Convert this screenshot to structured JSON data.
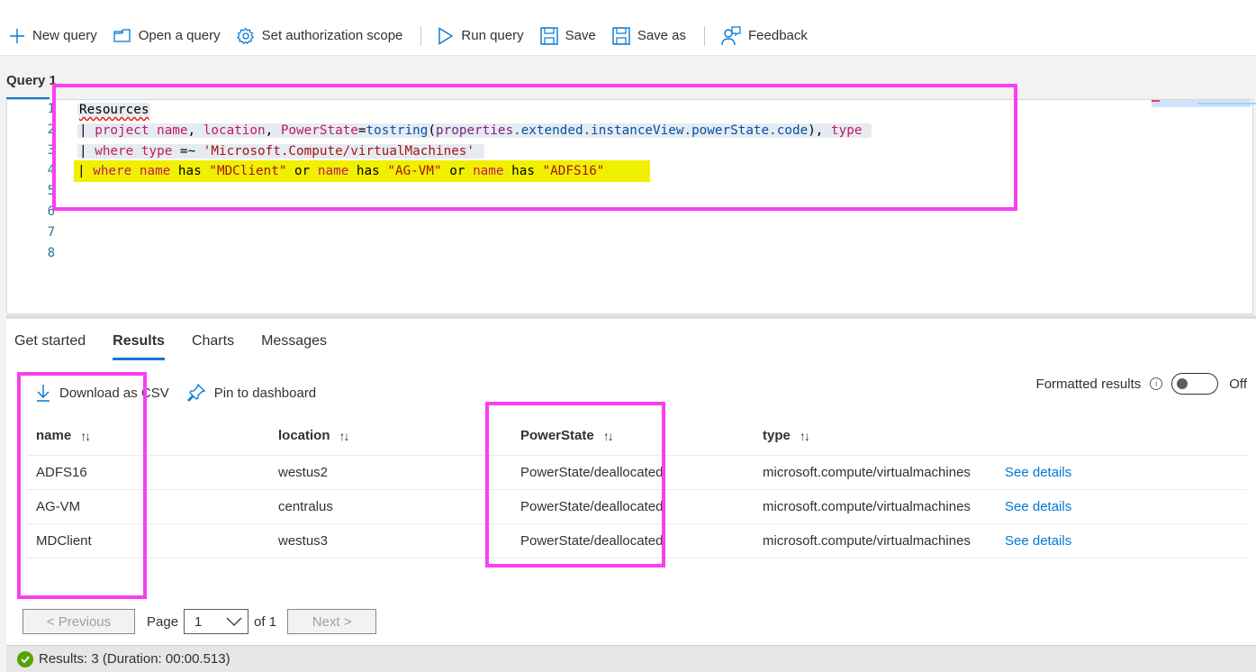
{
  "toolbar": {
    "new_query": "New query",
    "open_query": "Open a query",
    "set_scope": "Set authorization scope",
    "run_query": "Run query",
    "save": "Save",
    "save_as": "Save as",
    "feedback": "Feedback"
  },
  "query_tab": {
    "label": "Query 1"
  },
  "editor": {
    "line_numbers": [
      "1",
      "2",
      "3",
      "4",
      "5",
      "6",
      "7",
      "8"
    ],
    "lines": [
      "Resources",
      "| project name, location, PowerState=tostring(properties.extended.instanceView.powerState.code), type",
      "| where type =~ 'Microsoft.Compute/virtualMachines'",
      "| where name has \"MDClient\" or name has \"AG-VM\" or name has \"ADFS16\""
    ],
    "tokens": {
      "l1": {
        "resources": "Resources"
      },
      "l2": {
        "pipe": "|",
        "project": "project",
        "name": "name",
        "comma1": ",",
        "location": "location",
        "comma2": ",",
        "powerstate": "PowerState",
        "eq": "=",
        "tostring": "tostring",
        "lp": "(",
        "properties": "properties",
        "path": ".extended.instanceView.powerState.code",
        "rp": ")",
        "comma3": ",",
        "type": "type"
      },
      "l3": {
        "pipe": "|",
        "where": "where",
        "type": "type",
        "op": "=~",
        "str": "'Microsoft.Compute/virtualMachines'"
      },
      "l4": {
        "pipe": "|",
        "where": "where",
        "name1": "name",
        "has1": "has",
        "s1": "\"MDClient\"",
        "or1": "or",
        "name2": "name",
        "has2": "has",
        "s2": "\"AG-VM\"",
        "or2": "or",
        "name3": "name",
        "has3": "has",
        "s3": "\"ADFS16\""
      }
    }
  },
  "results_tabs": [
    {
      "label": "Get started",
      "active": false
    },
    {
      "label": "Results",
      "active": true
    },
    {
      "label": "Charts",
      "active": false
    },
    {
      "label": "Messages",
      "active": false
    }
  ],
  "actions": {
    "download_csv": "Download as CSV",
    "pin_dashboard": "Pin to dashboard"
  },
  "formatted_results": {
    "label": "Formatted results",
    "info": "i",
    "state": "Off"
  },
  "table": {
    "columns": [
      "name",
      "location",
      "PowerState",
      "type"
    ],
    "sort_glyph": "↑↓",
    "rows": [
      {
        "name": "ADFS16",
        "location": "westus2",
        "PowerState": "PowerState/deallocated",
        "type": "microsoft.compute/virtualmachines",
        "link": "See details"
      },
      {
        "name": "AG-VM",
        "location": "centralus",
        "PowerState": "PowerState/deallocated",
        "type": "microsoft.compute/virtualmachines",
        "link": "See details"
      },
      {
        "name": "MDClient",
        "location": "westus3",
        "PowerState": "PowerState/deallocated",
        "type": "microsoft.compute/virtualmachines",
        "link": "See details"
      }
    ]
  },
  "pager": {
    "previous": "< Previous",
    "page_label": "Page",
    "page_value": "1",
    "of_label": "of 1",
    "next": "Next >"
  },
  "status": {
    "text": "Results: 3 (Duration: 00:00.513)"
  },
  "colors": {
    "accent": "#0078d4",
    "annotation": "#f93ff0",
    "highlight": "#f0f000",
    "success": "#57a300"
  }
}
